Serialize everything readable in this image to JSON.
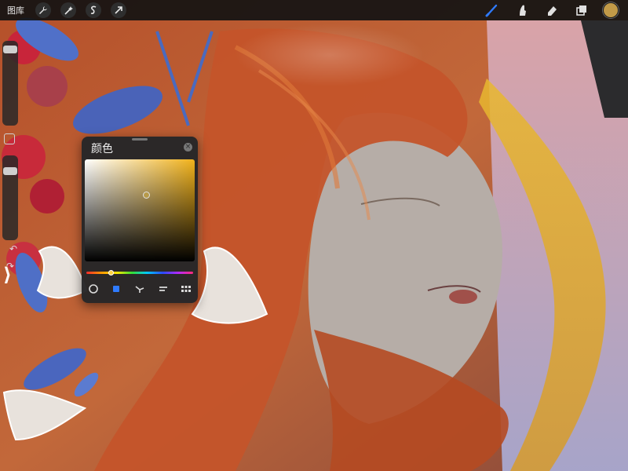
{
  "topbar": {
    "gallery_label": "图库",
    "left_tools": [
      {
        "name": "adjustments-wrench-icon"
      },
      {
        "name": "magic-wand-icon"
      },
      {
        "name": "selection-s-icon"
      },
      {
        "name": "transform-arrow-icon"
      }
    ],
    "right_tools": [
      {
        "name": "brush-icon",
        "active": true
      },
      {
        "name": "smudge-icon"
      },
      {
        "name": "eraser-icon"
      },
      {
        "name": "layers-icon"
      }
    ],
    "current_color": "#c29a48"
  },
  "sidebar": {
    "brush_size_level": 0.95,
    "opacity_level": 0.85
  },
  "color_panel": {
    "title": "颜色",
    "current_hue_color": "#f1b21b",
    "selected_color": "#b79a4a",
    "hue_position": 0.23,
    "modes": [
      {
        "name": "disc-mode-icon",
        "active": false
      },
      {
        "name": "classic-mode-icon",
        "active": true
      },
      {
        "name": "harmony-mode-icon",
        "active": false
      },
      {
        "name": "value-mode-icon",
        "active": false
      },
      {
        "name": "palettes-mode-icon",
        "active": false
      }
    ]
  },
  "colors": {
    "accent": "#2f7bff",
    "toolbar_bg": "#121212",
    "hair": "#c95a2a"
  }
}
